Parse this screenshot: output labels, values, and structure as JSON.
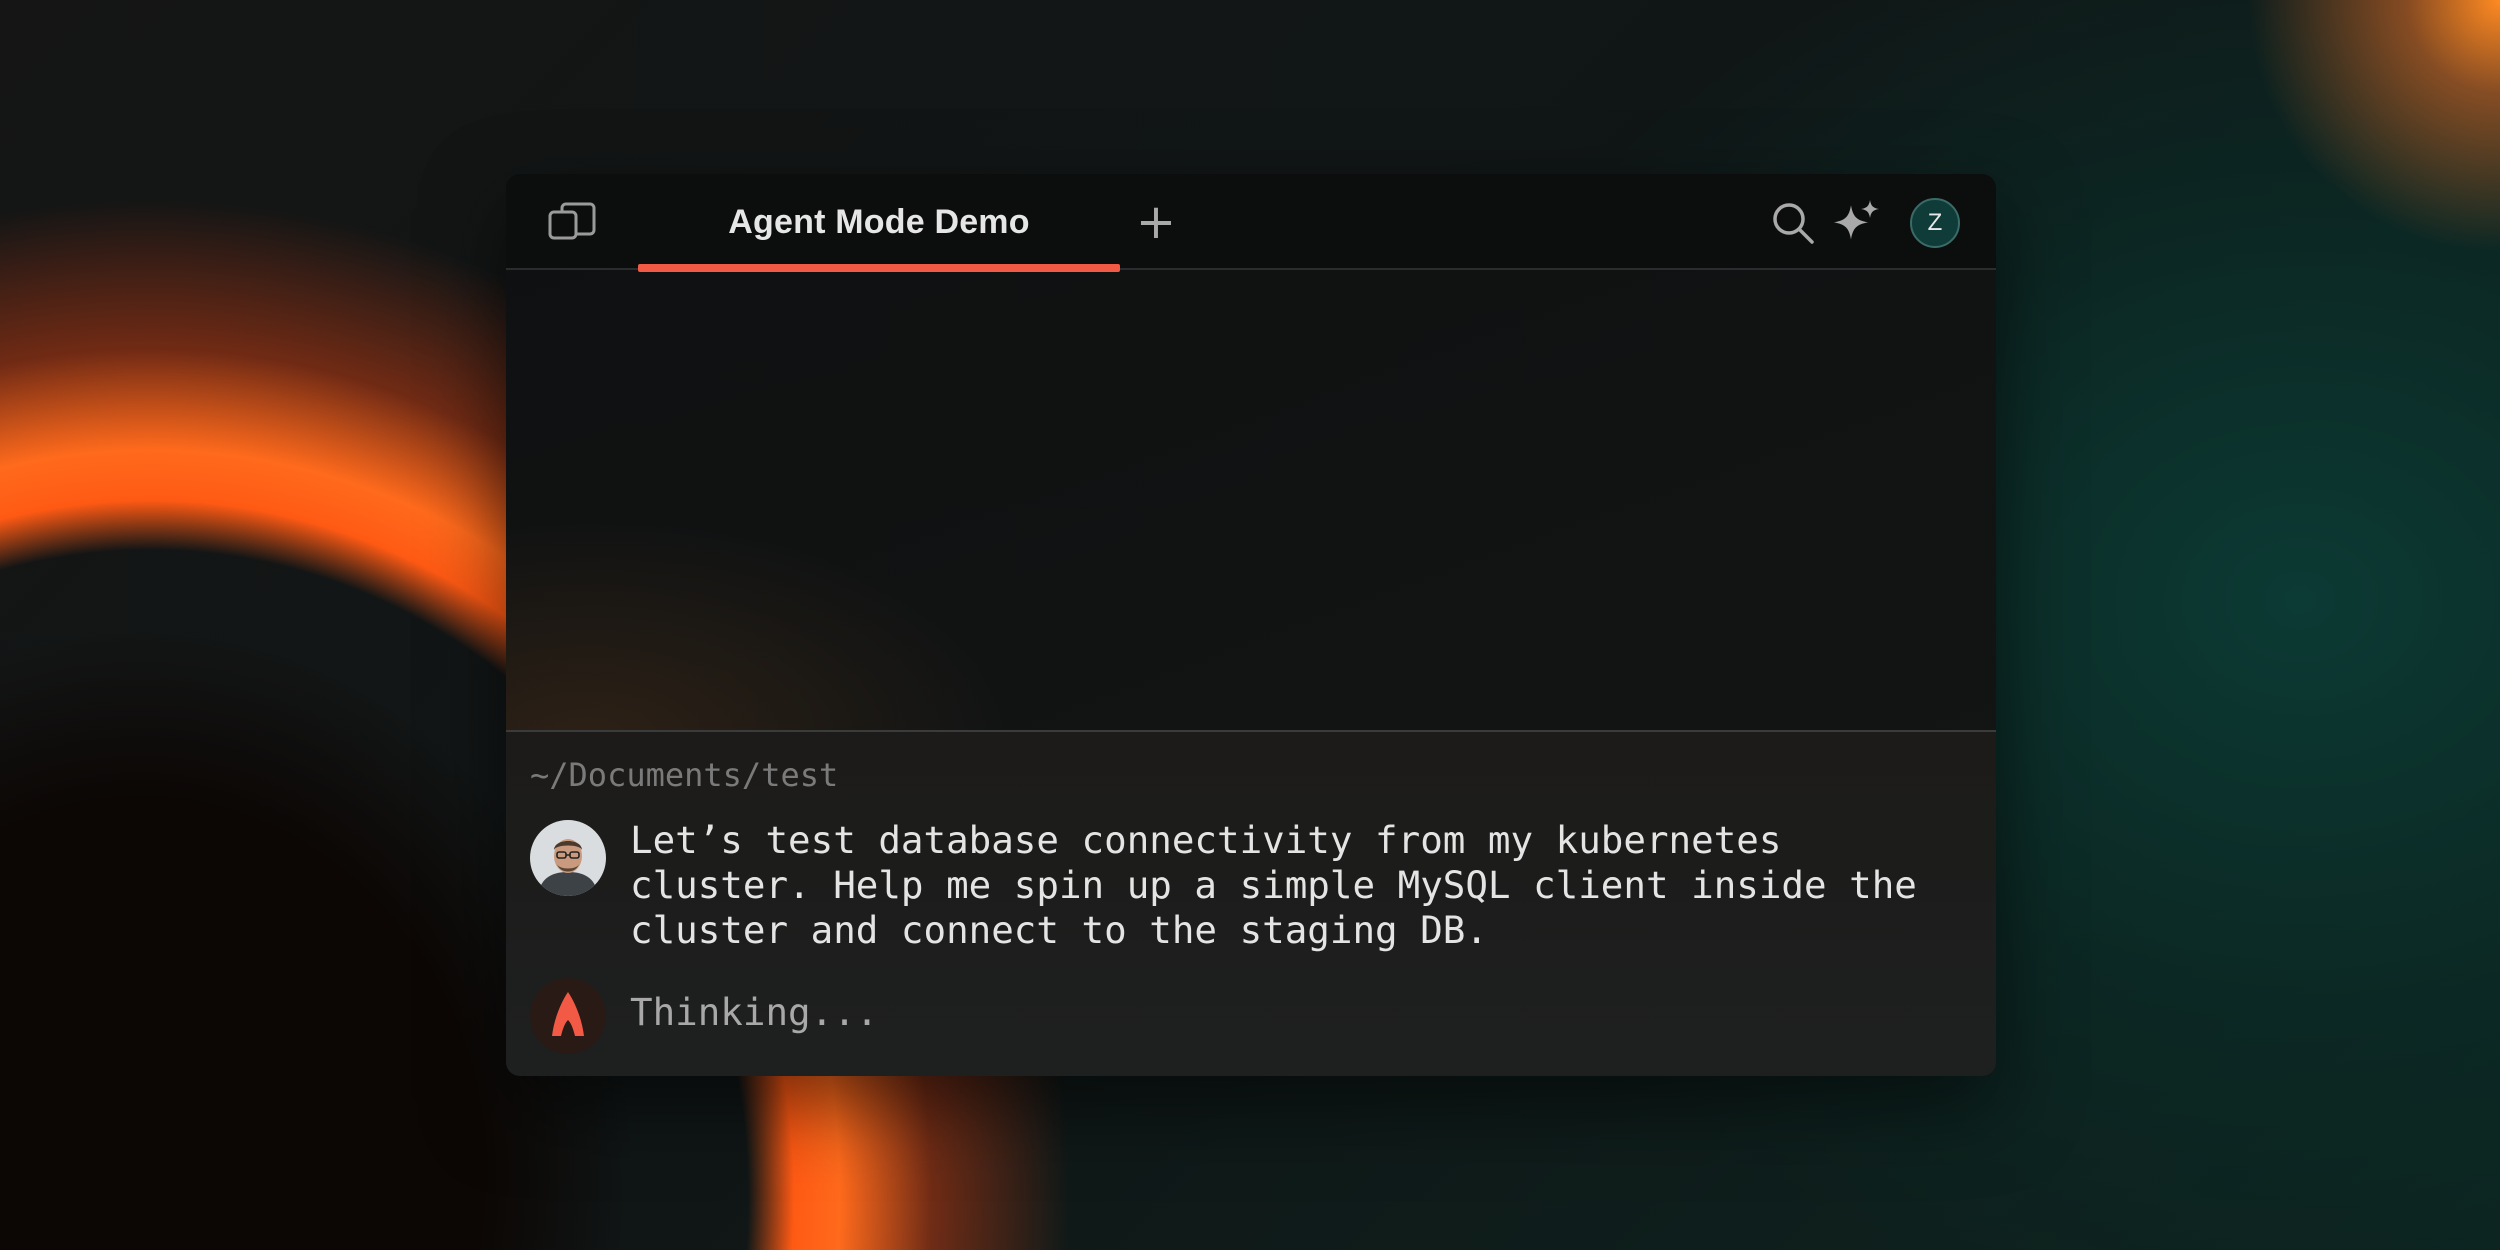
{
  "tabbar": {
    "panel_icon": "split-panel-icon",
    "active_tab": "Agent Mode Demo",
    "add_tab_label": "+",
    "search_icon": "search-icon",
    "ai_icon": "sparkle-icon",
    "account_initial": "Z"
  },
  "session": {
    "cwd": "~/Documents/test",
    "user_prompt": "Let’s test database connectivity from my kubernetes cluster. Help me spin up a simple MySQL client inside the cluster and connect to the staging DB.",
    "agent_status": "Thinking..."
  },
  "colors": {
    "accent": "#f25a45",
    "avatar_bg": "#0f3c38",
    "background_orange": "#ff5a14",
    "background_teal": "#0c3a34"
  }
}
